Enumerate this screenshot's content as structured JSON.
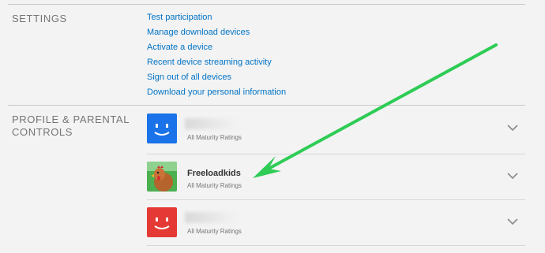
{
  "settings": {
    "title": "SETTINGS",
    "links": [
      "Test participation",
      "Manage download devices",
      "Activate a device",
      "Recent device streaming activity",
      "Sign out of all devices",
      "Download your personal information"
    ]
  },
  "profiles_section": {
    "title_line1": "PROFILE & PARENTAL",
    "title_line2": "CONTROLS",
    "profiles": [
      {
        "name": "",
        "rating": "All Maturity Ratings",
        "avatar_color": "#1a73e8",
        "avatar_icon": "smiley-icon"
      },
      {
        "name": "Freeloadkids",
        "rating": "All Maturity Ratings",
        "avatar_color": "#3a8f3a",
        "avatar_icon": "chicken-icon"
      },
      {
        "name": "",
        "rating": "All Maturity Ratings",
        "avatar_color": "#e53935",
        "avatar_icon": "smiley-icon"
      }
    ]
  },
  "annotation": {
    "arrow_color": "#2ecc55"
  }
}
